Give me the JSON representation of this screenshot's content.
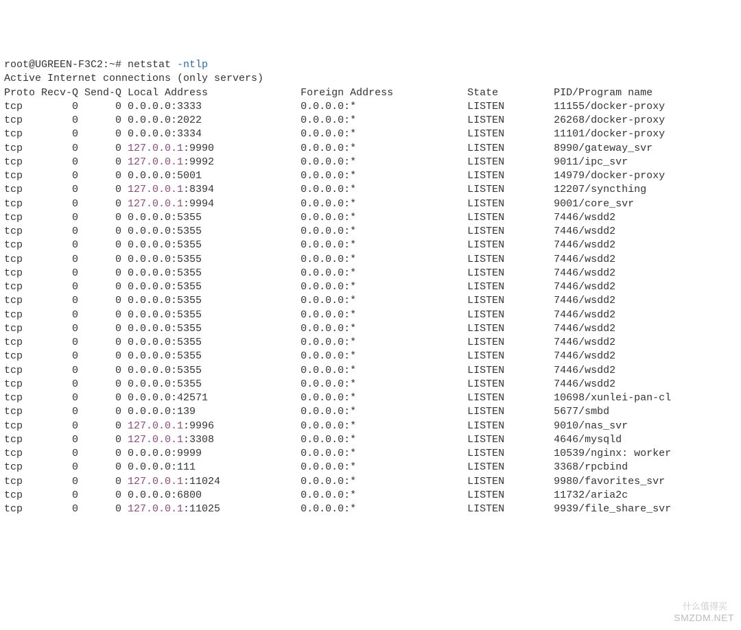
{
  "prompt": {
    "prefix": "root@UGREEN-F3C2:~# ",
    "command": "netstat ",
    "option": "-ntlp"
  },
  "header": "Active Internet connections (only servers)",
  "columns": {
    "proto": "Proto",
    "recvq": "Recv-Q",
    "sendq": "Send-Q",
    "local": "Local Address",
    "foreign": "Foreign Address",
    "state": "State",
    "pid": "PID/Program name"
  },
  "rows": [
    {
      "proto": "tcp",
      "recvq": "0",
      "sendq": "0",
      "local_ip": "0.0.0.0",
      "local_port": ":3333",
      "foreign": "0.0.0.0:*",
      "state": "LISTEN",
      "pid": "11155/docker-proxy"
    },
    {
      "proto": "tcp",
      "recvq": "0",
      "sendq": "0",
      "local_ip": "0.0.0.0",
      "local_port": ":2022",
      "foreign": "0.0.0.0:*",
      "state": "LISTEN",
      "pid": "26268/docker-proxy"
    },
    {
      "proto": "tcp",
      "recvq": "0",
      "sendq": "0",
      "local_ip": "0.0.0.0",
      "local_port": ":3334",
      "foreign": "0.0.0.0:*",
      "state": "LISTEN",
      "pid": "11101/docker-proxy"
    },
    {
      "proto": "tcp",
      "recvq": "0",
      "sendq": "0",
      "local_ip": "127.0.0.1",
      "local_port": ":9990",
      "foreign": "0.0.0.0:*",
      "state": "LISTEN",
      "pid": "8990/gateway_svr"
    },
    {
      "proto": "tcp",
      "recvq": "0",
      "sendq": "0",
      "local_ip": "127.0.0.1",
      "local_port": ":9992",
      "foreign": "0.0.0.0:*",
      "state": "LISTEN",
      "pid": "9011/ipc_svr"
    },
    {
      "proto": "tcp",
      "recvq": "0",
      "sendq": "0",
      "local_ip": "0.0.0.0",
      "local_port": ":5001",
      "foreign": "0.0.0.0:*",
      "state": "LISTEN",
      "pid": "14979/docker-proxy"
    },
    {
      "proto": "tcp",
      "recvq": "0",
      "sendq": "0",
      "local_ip": "127.0.0.1",
      "local_port": ":8394",
      "foreign": "0.0.0.0:*",
      "state": "LISTEN",
      "pid": "12207/syncthing"
    },
    {
      "proto": "tcp",
      "recvq": "0",
      "sendq": "0",
      "local_ip": "127.0.0.1",
      "local_port": ":9994",
      "foreign": "0.0.0.0:*",
      "state": "LISTEN",
      "pid": "9001/core_svr"
    },
    {
      "proto": "tcp",
      "recvq": "0",
      "sendq": "0",
      "local_ip": "0.0.0.0",
      "local_port": ":5355",
      "foreign": "0.0.0.0:*",
      "state": "LISTEN",
      "pid": "7446/wsdd2"
    },
    {
      "proto": "tcp",
      "recvq": "0",
      "sendq": "0",
      "local_ip": "0.0.0.0",
      "local_port": ":5355",
      "foreign": "0.0.0.0:*",
      "state": "LISTEN",
      "pid": "7446/wsdd2"
    },
    {
      "proto": "tcp",
      "recvq": "0",
      "sendq": "0",
      "local_ip": "0.0.0.0",
      "local_port": ":5355",
      "foreign": "0.0.0.0:*",
      "state": "LISTEN",
      "pid": "7446/wsdd2"
    },
    {
      "proto": "tcp",
      "recvq": "0",
      "sendq": "0",
      "local_ip": "0.0.0.0",
      "local_port": ":5355",
      "foreign": "0.0.0.0:*",
      "state": "LISTEN",
      "pid": "7446/wsdd2"
    },
    {
      "proto": "tcp",
      "recvq": "0",
      "sendq": "0",
      "local_ip": "0.0.0.0",
      "local_port": ":5355",
      "foreign": "0.0.0.0:*",
      "state": "LISTEN",
      "pid": "7446/wsdd2"
    },
    {
      "proto": "tcp",
      "recvq": "0",
      "sendq": "0",
      "local_ip": "0.0.0.0",
      "local_port": ":5355",
      "foreign": "0.0.0.0:*",
      "state": "LISTEN",
      "pid": "7446/wsdd2"
    },
    {
      "proto": "tcp",
      "recvq": "0",
      "sendq": "0",
      "local_ip": "0.0.0.0",
      "local_port": ":5355",
      "foreign": "0.0.0.0:*",
      "state": "LISTEN",
      "pid": "7446/wsdd2"
    },
    {
      "proto": "tcp",
      "recvq": "0",
      "sendq": "0",
      "local_ip": "0.0.0.0",
      "local_port": ":5355",
      "foreign": "0.0.0.0:*",
      "state": "LISTEN",
      "pid": "7446/wsdd2"
    },
    {
      "proto": "tcp",
      "recvq": "0",
      "sendq": "0",
      "local_ip": "0.0.0.0",
      "local_port": ":5355",
      "foreign": "0.0.0.0:*",
      "state": "LISTEN",
      "pid": "7446/wsdd2"
    },
    {
      "proto": "tcp",
      "recvq": "0",
      "sendq": "0",
      "local_ip": "0.0.0.0",
      "local_port": ":5355",
      "foreign": "0.0.0.0:*",
      "state": "LISTEN",
      "pid": "7446/wsdd2"
    },
    {
      "proto": "tcp",
      "recvq": "0",
      "sendq": "0",
      "local_ip": "0.0.0.0",
      "local_port": ":5355",
      "foreign": "0.0.0.0:*",
      "state": "LISTEN",
      "pid": "7446/wsdd2"
    },
    {
      "proto": "tcp",
      "recvq": "0",
      "sendq": "0",
      "local_ip": "0.0.0.0",
      "local_port": ":5355",
      "foreign": "0.0.0.0:*",
      "state": "LISTEN",
      "pid": "7446/wsdd2"
    },
    {
      "proto": "tcp",
      "recvq": "0",
      "sendq": "0",
      "local_ip": "0.0.0.0",
      "local_port": ":5355",
      "foreign": "0.0.0.0:*",
      "state": "LISTEN",
      "pid": "7446/wsdd2"
    },
    {
      "proto": "tcp",
      "recvq": "0",
      "sendq": "0",
      "local_ip": "0.0.0.0",
      "local_port": ":42571",
      "foreign": "0.0.0.0:*",
      "state": "LISTEN",
      "pid": "10698/xunlei-pan-cl"
    },
    {
      "proto": "tcp",
      "recvq": "0",
      "sendq": "0",
      "local_ip": "0.0.0.0",
      "local_port": ":139",
      "foreign": "0.0.0.0:*",
      "state": "LISTEN",
      "pid": "5677/smbd"
    },
    {
      "proto": "tcp",
      "recvq": "0",
      "sendq": "0",
      "local_ip": "127.0.0.1",
      "local_port": ":9996",
      "foreign": "0.0.0.0:*",
      "state": "LISTEN",
      "pid": "9010/nas_svr"
    },
    {
      "proto": "tcp",
      "recvq": "0",
      "sendq": "0",
      "local_ip": "127.0.0.1",
      "local_port": ":3308",
      "foreign": "0.0.0.0:*",
      "state": "LISTEN",
      "pid": "4646/mysqld"
    },
    {
      "proto": "tcp",
      "recvq": "0",
      "sendq": "0",
      "local_ip": "0.0.0.0",
      "local_port": ":9999",
      "foreign": "0.0.0.0:*",
      "state": "LISTEN",
      "pid": "10539/nginx: worker"
    },
    {
      "proto": "tcp",
      "recvq": "0",
      "sendq": "0",
      "local_ip": "0.0.0.0",
      "local_port": ":111",
      "foreign": "0.0.0.0:*",
      "state": "LISTEN",
      "pid": "3368/rpcbind"
    },
    {
      "proto": "tcp",
      "recvq": "0",
      "sendq": "0",
      "local_ip": "127.0.0.1",
      "local_port": ":11024",
      "foreign": "0.0.0.0:*",
      "state": "LISTEN",
      "pid": "9980/favorites_svr"
    },
    {
      "proto": "tcp",
      "recvq": "0",
      "sendq": "0",
      "local_ip": "0.0.0.0",
      "local_port": ":6800",
      "foreign": "0.0.0.0:*",
      "state": "LISTEN",
      "pid": "11732/aria2c"
    },
    {
      "proto": "tcp",
      "recvq": "0",
      "sendq": "0",
      "local_ip": "127.0.0.1",
      "local_port": ":11025",
      "foreign": "0.0.0.0:*",
      "state": "LISTEN",
      "pid": "9939/file_share_svr"
    }
  ],
  "watermark1": "什么值得买",
  "watermark2": "SMZDM.NET"
}
